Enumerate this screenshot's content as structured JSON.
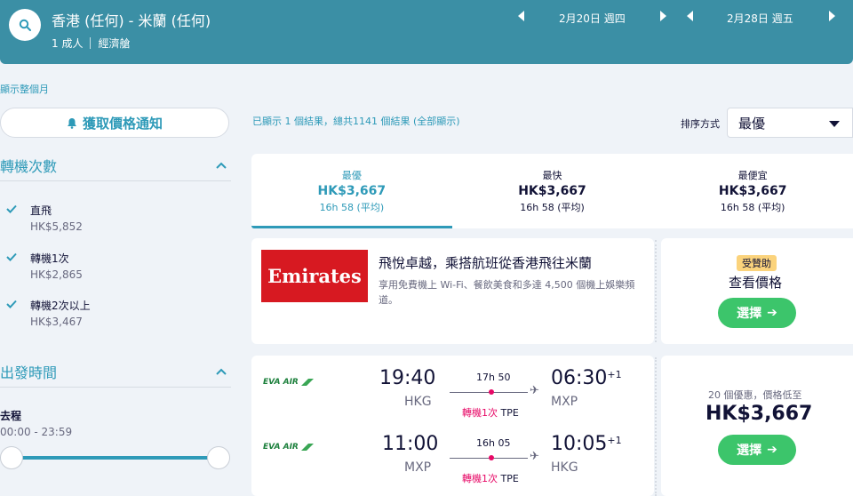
{
  "header": {
    "route": "香港 (任何) - 米蘭 (任何)",
    "passengers": "1 成人",
    "cabin": "經濟艙",
    "depart_date": "2月20日 週四",
    "return_date": "2月28日 週五"
  },
  "month_link": "顯示整個月",
  "sidebar": {
    "alert_button": "獲取價格通知",
    "stops_title": "轉機次數",
    "stops": [
      {
        "label": "直飛",
        "price": "HK$5,852",
        "checked": true
      },
      {
        "label": "轉機1次",
        "price": "HK$2,865",
        "checked": true
      },
      {
        "label": "轉機2次以上",
        "price": "HK$3,467",
        "checked": true
      }
    ],
    "depart_time_title": "出發時間",
    "outbound_label": "去程",
    "time_range": "00:00 - 23:59"
  },
  "results": {
    "count_text": "已顯示 1 個結果，總共1141 個結果 (全部顯示)",
    "sort_label": "排序方式",
    "sort_value": "最優"
  },
  "tabs": [
    {
      "label": "最優",
      "price": "HK$3,667",
      "duration": "16h 58 (平均)",
      "active": true
    },
    {
      "label": "最快",
      "price": "HK$3,667",
      "duration": "16h 58 (平均)",
      "active": false
    },
    {
      "label": "最便宜",
      "price": "HK$3,667",
      "duration": "16h 58 (平均)",
      "active": false
    }
  ],
  "ad": {
    "logo_text": "Emirates",
    "title": "飛悅卓越，乘搭航班從香港飛往米蘭",
    "description": "享用免費機上 Wi-Fi、餐飲美食和多達 4,500 個機上娛樂頻道。",
    "sponsored": "受贊助",
    "view_price": "查看價格",
    "select": "選擇"
  },
  "itinerary": {
    "airline": "EVA AIR",
    "legs": [
      {
        "depart_time": "19:40",
        "depart_code": "HKG",
        "duration": "17h 50",
        "stops": "轉機1次",
        "via": "TPE",
        "arrive_time": "06:30",
        "arrive_offset": "+1",
        "arrive_code": "MXP"
      },
      {
        "depart_time": "11:00",
        "depart_code": "MXP",
        "duration": "16h 05",
        "stops": "轉機1次",
        "via": "TPE",
        "arrive_time": "10:05",
        "arrive_offset": "+1",
        "arrive_code": "HKG"
      }
    ],
    "deals_text": "20 個優惠，價格低至",
    "price": "HK$3,667",
    "select": "選擇"
  },
  "colors": {
    "header_bg": "#3b8fa5",
    "accent": "#2e9ab8",
    "select_green": "#3cc56b",
    "stop_red": "#e70866",
    "emirates_red": "#d71921"
  }
}
